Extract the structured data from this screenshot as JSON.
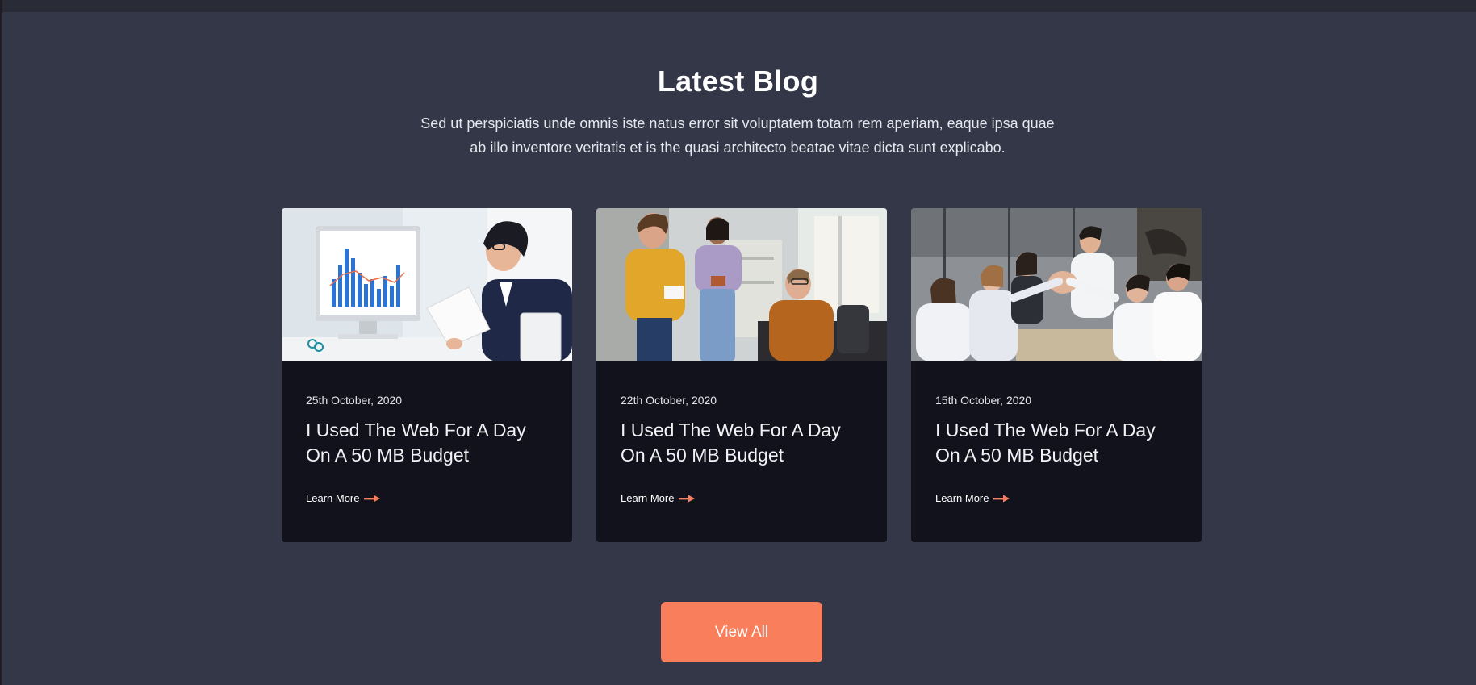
{
  "section": {
    "title": "Latest Blog",
    "subtitle_line1": "Sed ut perspiciatis unde omnis iste natus error sit voluptatem totam rem aperiam, eaque ipsa quae",
    "subtitle_line2": "ab illo inventore veritatis et is the quasi architecto beatae vitae dicta sunt explicabo."
  },
  "posts": [
    {
      "date": "25th October, 2020",
      "title": "I Used The Web For A Day On A 50 MB Budget",
      "link_label": "Learn More",
      "image": "man-analyzing-chart-photo"
    },
    {
      "date": "22th October, 2020",
      "title": "I Used The Web For A Day On A 50 MB Budget",
      "link_label": "Learn More",
      "image": "team-discussion-office-photo"
    },
    {
      "date": "15th October, 2020",
      "title": "I Used The Web For A Day On A 50 MB Budget",
      "link_label": "Learn More",
      "image": "team-high-five-photo"
    }
  ],
  "view_all_label": "View All",
  "colors": {
    "background": "#343747",
    "card": "#12121c",
    "accent": "#f87e5c"
  }
}
